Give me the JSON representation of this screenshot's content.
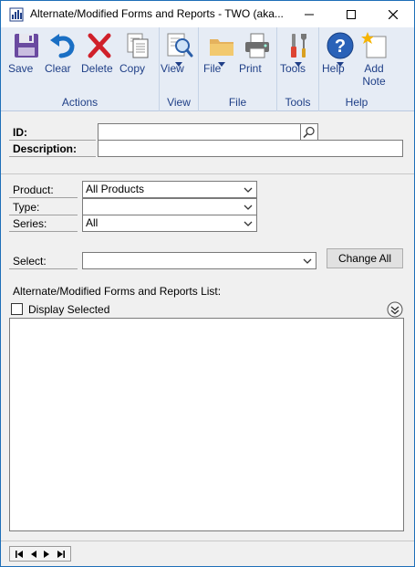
{
  "window": {
    "title": "Alternate/Modified Forms and Reports  -  TWO (aka...",
    "controls": [
      "minimize-icon",
      "maximize-icon",
      "close-icon"
    ]
  },
  "ribbon": {
    "groups": [
      {
        "label": "Actions",
        "buttons": [
          {
            "label": "Save",
            "icon": "save-icon"
          },
          {
            "label": "Clear",
            "icon": "undo-icon"
          },
          {
            "label": "Delete",
            "icon": "delete-x-icon"
          },
          {
            "label": "Copy",
            "icon": "copy-icon"
          }
        ]
      },
      {
        "label": "View",
        "buttons": [
          {
            "label": "View",
            "icon": "magnifier-document-icon",
            "dropdown": true
          }
        ]
      },
      {
        "label": "File",
        "buttons": [
          {
            "label": "File",
            "icon": "folder-icon",
            "dropdown": true
          },
          {
            "label": "Print",
            "icon": "printer-icon"
          }
        ]
      },
      {
        "label": "Tools",
        "buttons": [
          {
            "label": "Tools",
            "icon": "tools-icon",
            "dropdown": true
          }
        ]
      },
      {
        "label": "Help",
        "buttons": [
          {
            "label": "Help",
            "icon": "help-icon",
            "dropdown": true
          },
          {
            "label": "Add Note",
            "icon": "add-note-icon"
          }
        ]
      }
    ]
  },
  "form": {
    "id_label": "ID:",
    "id_value": "",
    "description_label": "Description:",
    "description_value": "",
    "product_label": "Product:",
    "product_value": "All Products",
    "type_label": "Type:",
    "type_value": "",
    "series_label": "Series:",
    "series_value": "All",
    "select_label": "Select:",
    "select_value": "",
    "change_all_label": "Change All",
    "list_title": "Alternate/Modified Forms and Reports List:",
    "display_selected_label": "Display Selected",
    "display_selected_checked": false
  },
  "statusbar": {
    "nav": [
      "first-record-icon",
      "previous-record-icon",
      "next-record-icon",
      "last-record-icon"
    ]
  }
}
